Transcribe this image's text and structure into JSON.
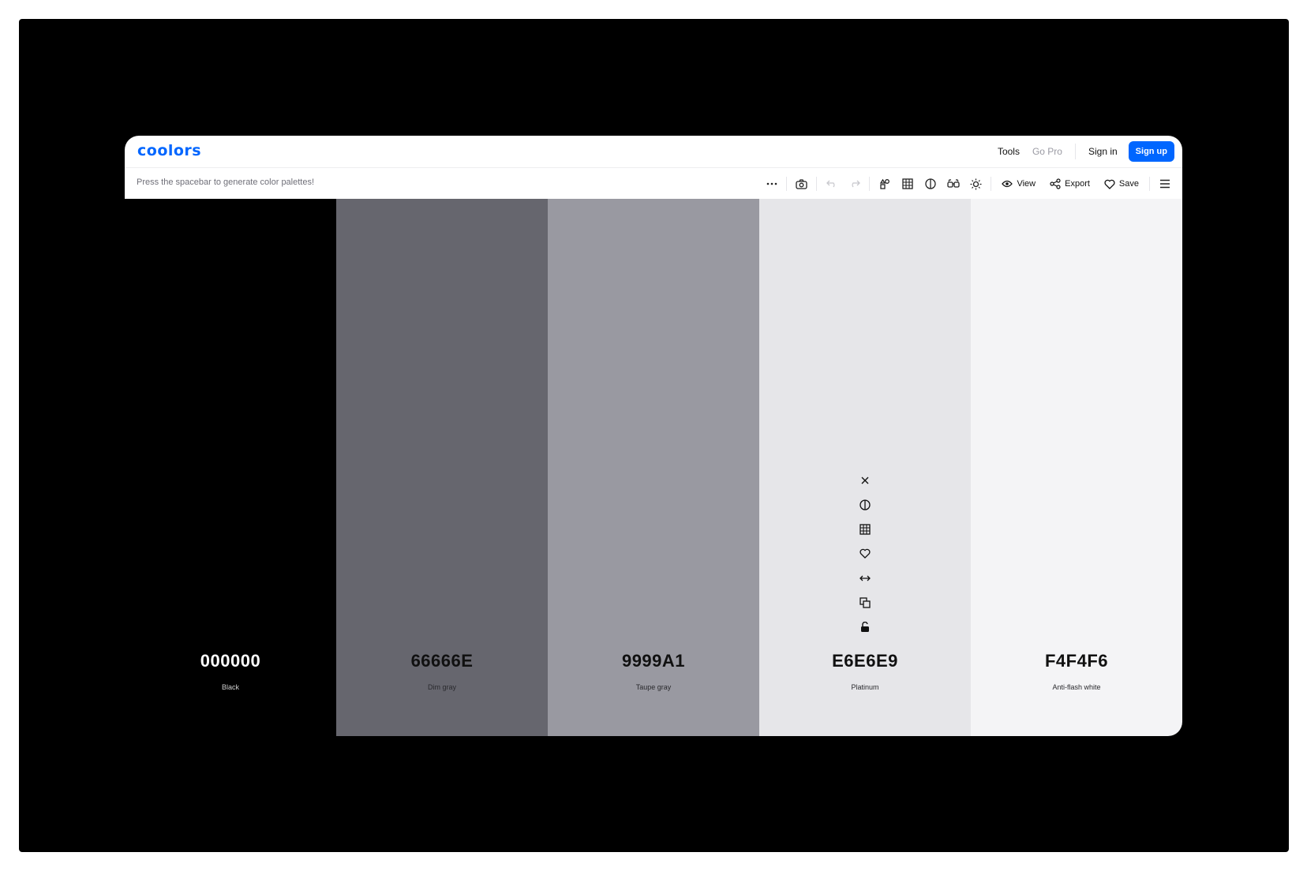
{
  "nav": {
    "logo": "coolors",
    "tools": "Tools",
    "go_pro": "Go Pro",
    "sign_in": "Sign in",
    "sign_up": "Sign up"
  },
  "toolbar": {
    "hint": "Press the spacebar to generate color palettes!",
    "view_label": "View",
    "export_label": "Export",
    "save_label": "Save",
    "icons": [
      "more-icon",
      "camera-icon",
      "undo-icon",
      "redo-icon",
      "adjust-palette-icon",
      "grid-icon",
      "contrast-icon",
      "glasses-icon",
      "sun-icon",
      "eye-icon",
      "share-icon",
      "heart-icon",
      "menu-icon"
    ]
  },
  "palette": {
    "colors": [
      {
        "hex": "000000",
        "name": "Black",
        "bg": "#000000",
        "text": "#ffffff",
        "sub": "#cfcfcf"
      },
      {
        "hex": "66666E",
        "name": "Dim gray",
        "bg": "#66666e",
        "text": "#111111",
        "sub": "#2a2a2e"
      },
      {
        "hex": "9999A1",
        "name": "Taupe gray",
        "bg": "#9999a1",
        "text": "#111111",
        "sub": "#2a2a2e"
      },
      {
        "hex": "E6E6E9",
        "name": "Platinum",
        "bg": "#e6e6e9",
        "text": "#111111",
        "sub": "#2a2a2e"
      },
      {
        "hex": "F4F4F6",
        "name": "Anti-flash white",
        "bg": "#f4f4f6",
        "text": "#111111",
        "sub": "#2a2a2e"
      }
    ],
    "active_swatch_tools": [
      "close-icon",
      "contrast-icon",
      "shades-grid-icon",
      "heart-icon",
      "drag-icon",
      "copy-icon",
      "lock-icon"
    ]
  },
  "colors": {
    "accent": "#0066ff"
  }
}
